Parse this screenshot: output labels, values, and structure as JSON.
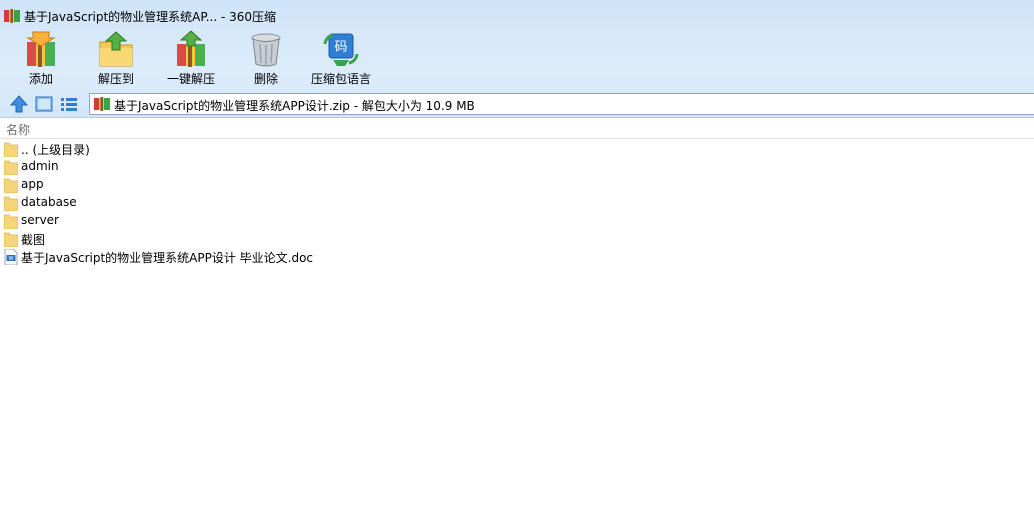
{
  "window": {
    "title": "基于JavaScript的物业管理系统AP... - 360压缩"
  },
  "toolbar": {
    "items": [
      {
        "label": "添加",
        "icon": "add-archive-icon"
      },
      {
        "label": "解压到",
        "icon": "extract-to-icon"
      },
      {
        "label": "一键解压",
        "icon": "one-click-extract-icon"
      },
      {
        "label": "删除",
        "icon": "delete-icon"
      },
      {
        "label": "压缩包语言",
        "icon": "archive-language-icon"
      }
    ]
  },
  "nav": {
    "up_icon": "up-arrow-icon",
    "view_icon": "thumbnail-view-icon",
    "list_icon": "list-view-icon",
    "address": "基于JavaScript的物业管理系统APP设计.zip - 解包大小为 10.9 MB"
  },
  "list": {
    "column_name": "名称",
    "rows": [
      {
        "name": ".. (上级目录)",
        "type": "folder"
      },
      {
        "name": "admin",
        "type": "folder"
      },
      {
        "name": "app",
        "type": "folder"
      },
      {
        "name": "database",
        "type": "folder"
      },
      {
        "name": "server",
        "type": "folder"
      },
      {
        "name": "截图",
        "type": "folder"
      },
      {
        "name": "基于JavaScript的物业管理系统APP设计 毕业论文.doc",
        "type": "doc"
      }
    ]
  },
  "colors": {
    "chrome_top": "#cfe3f7",
    "folder": "#f5d57a",
    "accent_blue": "#2f7fd6"
  }
}
